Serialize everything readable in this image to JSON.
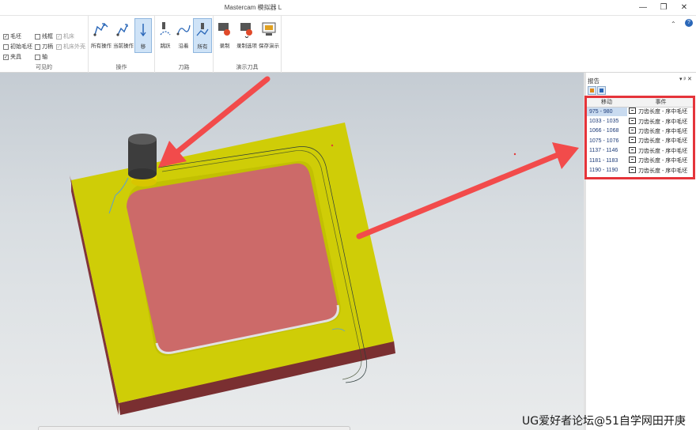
{
  "app": {
    "title": "Mastercam 模拟器 L"
  },
  "window_controls": {
    "minimize": "—",
    "maximize": "❐",
    "close": "✕"
  },
  "ribbon": {
    "collapse": "⌃",
    "help": "?",
    "visible": {
      "label": "可见的",
      "checkboxes": [
        {
          "label": "毛坯",
          "checked": true,
          "enabled": true
        },
        {
          "label": "线框",
          "checked": false,
          "enabled": true
        },
        {
          "label": "机床",
          "checked": true,
          "enabled": false
        },
        {
          "label": "初始毛坯",
          "checked": false,
          "enabled": true
        },
        {
          "label": "刀柄",
          "checked": false,
          "enabled": true
        },
        {
          "label": "机床外壳",
          "checked": true,
          "enabled": false
        },
        {
          "label": "夹具",
          "checked": true,
          "enabled": true
        },
        {
          "label": "轴",
          "checked": false,
          "enabled": true
        }
      ]
    },
    "operations": {
      "label": "操作",
      "buttons": [
        "所有操作",
        "当前操作",
        "移"
      ]
    },
    "toolpath": {
      "label": "刀路",
      "buttons": [
        "跳跃",
        "沿着",
        "所有"
      ]
    },
    "demo": {
      "label": "演示刀具",
      "buttons": [
        "录制",
        "录制选项",
        "保存演示"
      ]
    }
  },
  "report": {
    "title": "报告",
    "pin": "▾ ᵖ ✕",
    "columns": [
      "移动",
      "事件"
    ],
    "rows": [
      {
        "moves": "975 - 980",
        "event": "刀齿长度 - 序中毛坯"
      },
      {
        "moves": "1033 - 1035",
        "event": "刀齿长度 - 序中毛坯"
      },
      {
        "moves": "1066 - 1068",
        "event": "刀齿长度 - 序中毛坯"
      },
      {
        "moves": "1075 - 1076",
        "event": "刀齿长度 - 序中毛坯"
      },
      {
        "moves": "1137 - 1146",
        "event": "刀齿长度 - 序中毛坯"
      },
      {
        "moves": "1181 - 1183",
        "event": "刀齿长度 - 序中毛坯"
      },
      {
        "moves": "1190 - 1190",
        "event": "刀齿长度 - 序中毛坯"
      }
    ]
  },
  "watermark": "UG爱好者论坛@51自学网田开庚",
  "colors": {
    "stock_top": "#cfcd07",
    "stock_side": "#7a3032",
    "pocket": "#cc6a69",
    "annotation_arrow": "#f24b4b",
    "tool_holder": "#3d3d3d",
    "tool_collar": "#e8d400",
    "selection": "#c9dbf0"
  }
}
